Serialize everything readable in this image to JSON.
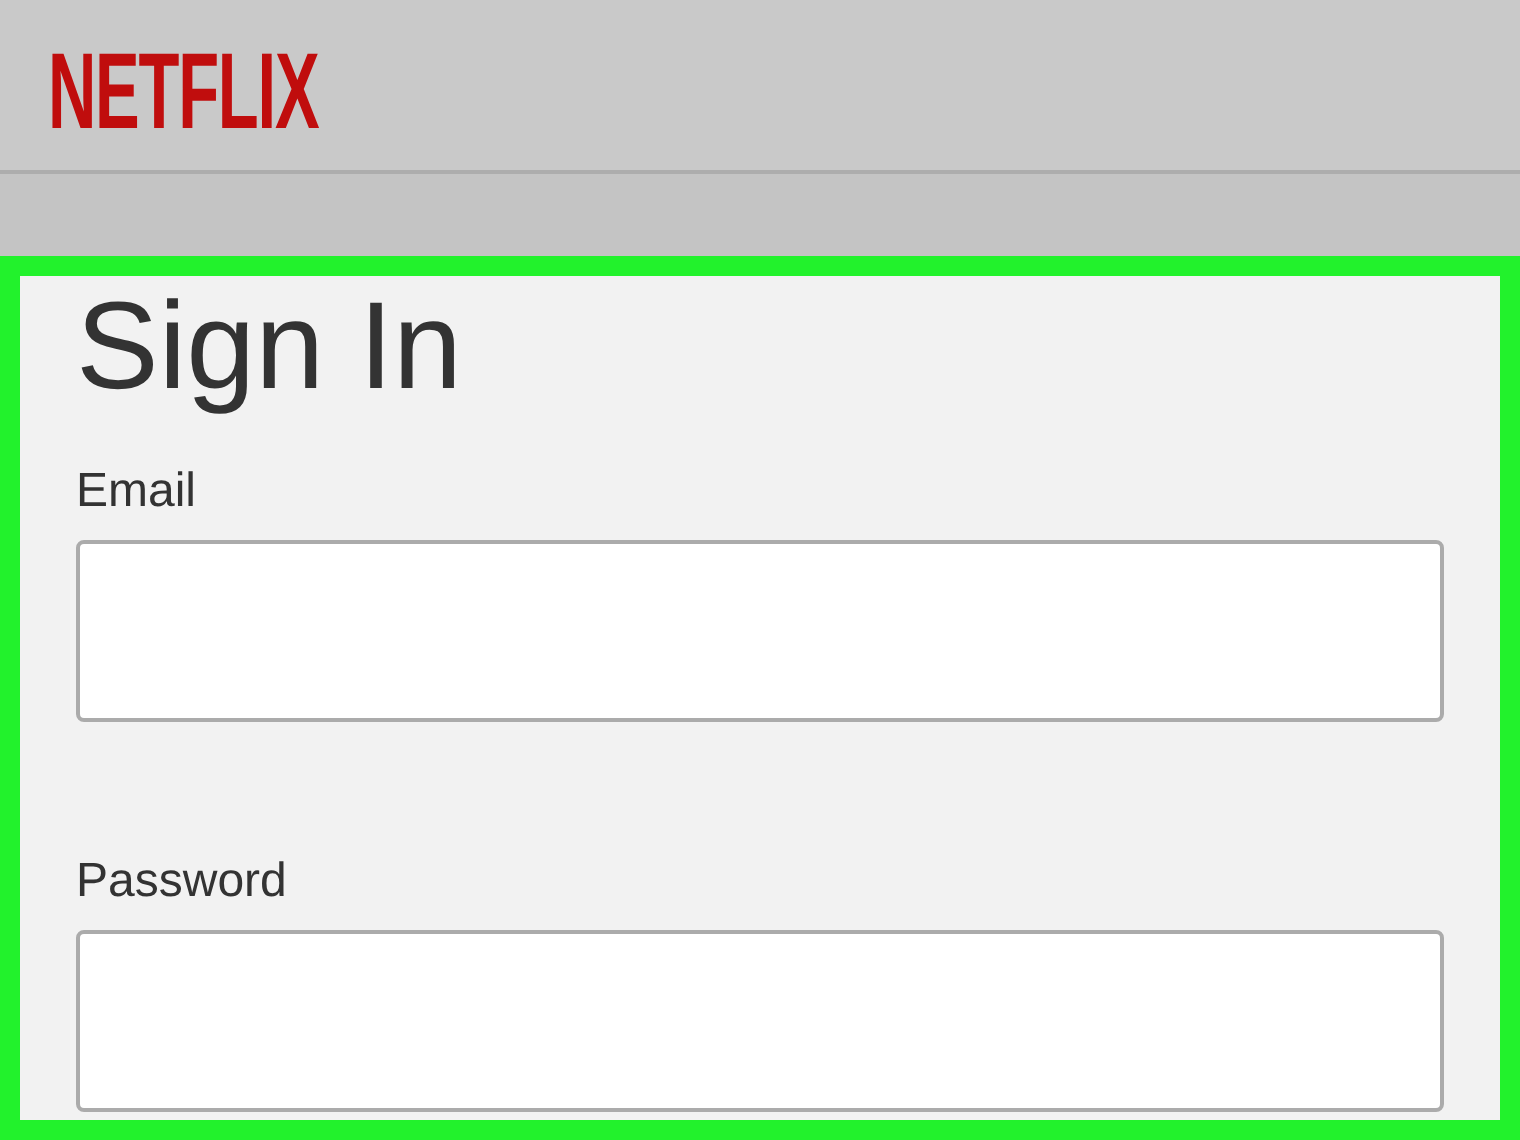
{
  "header": {
    "logo": "NETFLIX"
  },
  "form": {
    "highlighted": true,
    "title": "Sign In",
    "fields": [
      {
        "label": "Email"
      },
      {
        "label": "Password"
      }
    ]
  }
}
